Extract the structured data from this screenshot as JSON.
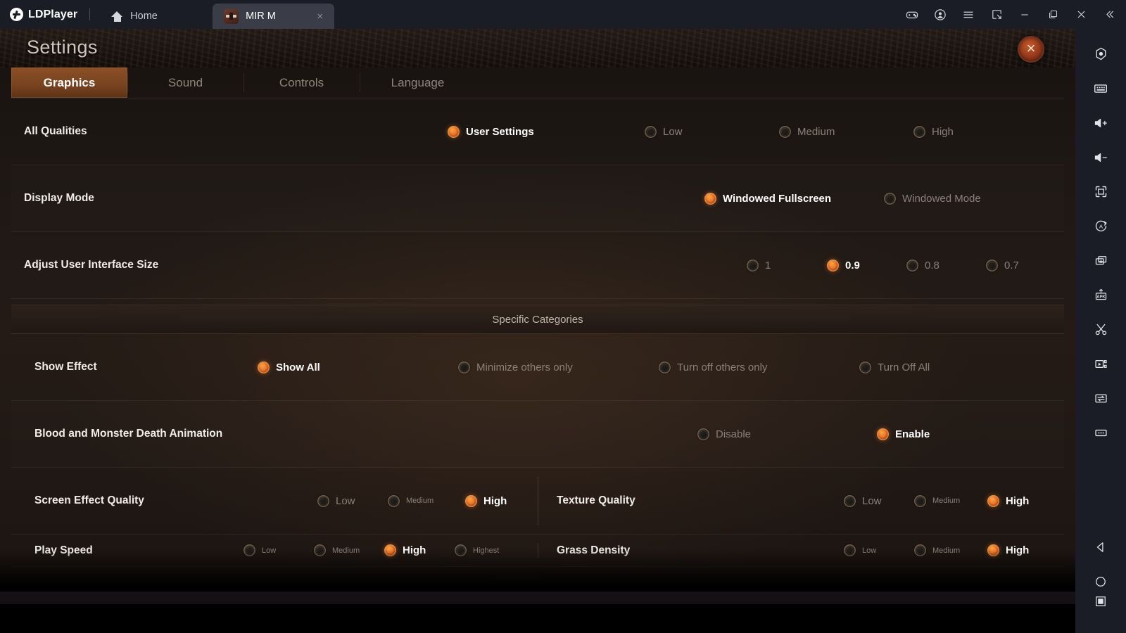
{
  "window": {
    "brand": "LDPlayer",
    "tabs": [
      {
        "label": "Home",
        "icon": "home-icon",
        "active": false
      },
      {
        "label": "MIR M",
        "icon": "game-icon",
        "active": true,
        "close": "×"
      }
    ],
    "controls": [
      {
        "name": "gamepad-icon",
        "title": "Gamepad"
      },
      {
        "name": "account-icon",
        "title": "Account"
      },
      {
        "name": "menu-icon",
        "title": "Menu"
      },
      {
        "name": "screenshot-icon",
        "title": "Screenshot"
      },
      {
        "name": "minimize-icon",
        "title": "Minimize"
      },
      {
        "name": "maximize-icon",
        "title": "Maximize"
      },
      {
        "name": "close-icon",
        "title": "Close"
      },
      {
        "name": "collapse-icon",
        "title": "Collapse"
      }
    ]
  },
  "settings": {
    "title": "Settings",
    "close_label": "×",
    "tabs": [
      {
        "label": "Graphics",
        "active": true
      },
      {
        "label": "Sound",
        "active": false
      },
      {
        "label": "Controls",
        "active": false
      },
      {
        "label": "Language",
        "active": false
      }
    ],
    "section_label": "Specific Categories",
    "rows": [
      {
        "label": "All Qualities",
        "options": [
          {
            "label": "User Settings",
            "selected": true
          },
          {
            "label": "Low",
            "selected": false
          },
          {
            "label": "Medium",
            "selected": false
          },
          {
            "label": "High",
            "selected": false
          }
        ]
      },
      {
        "label": "Display Mode",
        "options": [
          {
            "label": "Windowed Fullscreen",
            "selected": true
          },
          {
            "label": "Windowed Mode",
            "selected": false
          }
        ]
      },
      {
        "label": "Adjust User Interface Size",
        "options": [
          {
            "label": "1",
            "selected": false
          },
          {
            "label": "0.9",
            "selected": true
          },
          {
            "label": "0.8",
            "selected": false
          },
          {
            "label": "0.7",
            "selected": false
          }
        ]
      }
    ],
    "specific_rows": [
      {
        "label": "Show Effect",
        "options": [
          {
            "label": "Show All",
            "selected": true
          },
          {
            "label": "Minimize others only",
            "selected": false
          },
          {
            "label": "Turn off others only",
            "selected": false
          },
          {
            "label": "Turn Off All",
            "selected": false
          }
        ]
      },
      {
        "label": "Blood and Monster Death Animation",
        "options": [
          {
            "label": "Disable",
            "selected": false
          },
          {
            "label": "Enable",
            "selected": true
          }
        ]
      }
    ],
    "split_rows": [
      {
        "left": {
          "label": "Screen Effect Quality",
          "options": [
            {
              "label": "Low",
              "selected": false,
              "small": false
            },
            {
              "label": "Medium",
              "selected": false,
              "small": true
            },
            {
              "label": "High",
              "selected": true,
              "small": false
            }
          ]
        },
        "right": {
          "label": "Texture Quality",
          "options": [
            {
              "label": "Low",
              "selected": false,
              "small": false
            },
            {
              "label": "Medium",
              "selected": false,
              "small": true
            },
            {
              "label": "High",
              "selected": true,
              "small": false
            }
          ]
        }
      },
      {
        "left": {
          "label": "Play Speed",
          "options": [
            {
              "label": "Low",
              "selected": false,
              "small": true
            },
            {
              "label": "Medium",
              "selected": false,
              "small": true
            },
            {
              "label": "High",
              "selected": true,
              "small": false
            },
            {
              "label": "Highest",
              "selected": false,
              "small": true
            }
          ]
        },
        "right": {
          "label": "Grass Density",
          "options": [
            {
              "label": "Low",
              "selected": false,
              "small": true
            },
            {
              "label": "Medium",
              "selected": false,
              "small": true
            },
            {
              "label": "High",
              "selected": true,
              "small": false
            }
          ]
        }
      }
    ]
  },
  "toolbar": {
    "items": [
      {
        "name": "record-macro-icon"
      },
      {
        "name": "keyboard-icon"
      },
      {
        "name": "volume-up-icon"
      },
      {
        "name": "volume-down-icon"
      },
      {
        "name": "fullscreen-icon"
      },
      {
        "name": "rotate-screen-icon"
      },
      {
        "name": "multi-instance-icon"
      },
      {
        "name": "install-apk-icon"
      },
      {
        "name": "scissors-icon"
      },
      {
        "name": "video-record-icon"
      },
      {
        "name": "file-transfer-icon"
      },
      {
        "name": "more-options-icon"
      }
    ],
    "nav": [
      {
        "name": "android-back-icon"
      },
      {
        "name": "android-home-icon"
      },
      {
        "name": "android-recents-icon"
      }
    ]
  },
  "colors": {
    "accent": "#e2641b",
    "tab_active": "#7a4420",
    "titlebar": "#1b1d26",
    "panel_bg": "#241b16"
  }
}
